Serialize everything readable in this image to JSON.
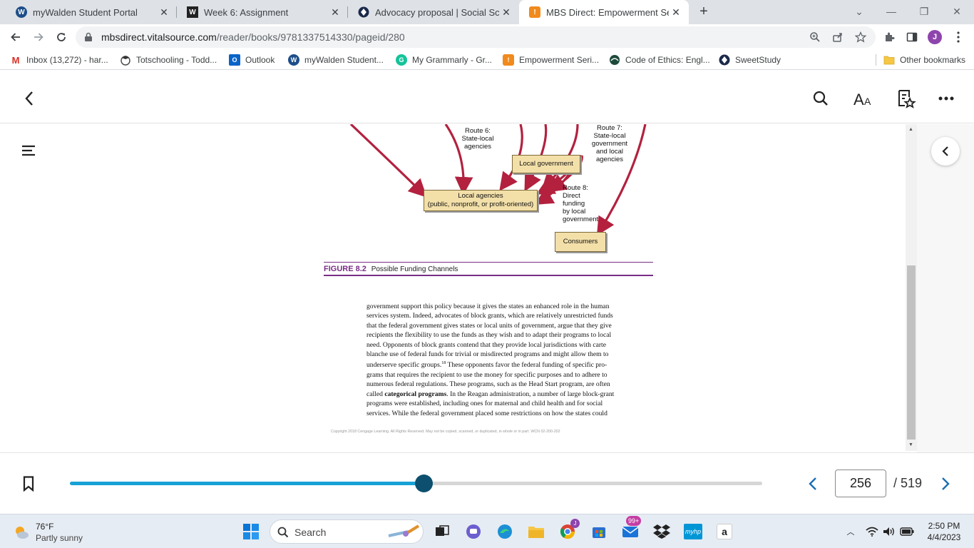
{
  "browser": {
    "tabs": [
      {
        "title": "myWalden Student Portal",
        "icon": "walden-icon",
        "icon_color": "#1d4e89",
        "icon_text": "W"
      },
      {
        "title": "Week 6: Assignment",
        "icon": "walden-w-icon",
        "icon_color": "#222222",
        "icon_text": "W"
      },
      {
        "title": "Advocacy proposal | Social Scienc",
        "icon": "sweetstudy-icon",
        "icon_color": "#1b2a4a",
        "icon_text": ""
      },
      {
        "title": "MBS Direct: Empowerment Serie",
        "icon": "mbs-icon",
        "icon_color": "#f08a1c",
        "icon_text": "!",
        "active": true
      }
    ],
    "url_host": "mbsdirect.vitalsource.com",
    "url_path": "/reader/books/9781337514330/pageid/280",
    "profile_initial": "J",
    "bookmarks": [
      {
        "label": "Inbox (13,272) - har...",
        "icon": "gmail-icon",
        "color": "#d93025",
        "text": "M"
      },
      {
        "label": "Totschooling - Todd...",
        "icon": "totschooling-icon",
        "color": "#555555",
        "text": ""
      },
      {
        "label": "Outlook",
        "icon": "outlook-icon",
        "color": "#0a64c8",
        "text": "O"
      },
      {
        "label": "myWalden Student...",
        "icon": "walden-icon",
        "color": "#1d4e89",
        "text": "W"
      },
      {
        "label": "My Grammarly - Gr...",
        "icon": "grammarly-icon",
        "color": "#15c39a",
        "text": "G"
      },
      {
        "label": "Empowerment Seri...",
        "icon": "mbs-icon",
        "color": "#f08a1c",
        "text": "!"
      },
      {
        "label": "Code of Ethics: Engl...",
        "icon": "nasw-icon",
        "color": "#1d4a3a",
        "text": ""
      },
      {
        "label": "SweetStudy",
        "icon": "sweetstudy-icon",
        "color": "#1b2a4a",
        "text": ""
      }
    ],
    "other_bookmarks": "Other bookmarks"
  },
  "figure": {
    "route6": [
      "Route 6:",
      "State-local",
      "agencies"
    ],
    "route7": [
      "Route 7:",
      "State-local",
      "government",
      "and local",
      "agencies"
    ],
    "route8": [
      "Route 8:",
      "Direct",
      "funding",
      "by local",
      "government"
    ],
    "local_government": "Local government",
    "local_agencies_1": "Local agencies",
    "local_agencies_2": "(public, nonprofit, or profit-oriented)",
    "consumers": "Consumers",
    "caption_number": "FIGURE 8.2",
    "caption_title": "Possible Funding Channels",
    "arrow_color": "#b3213f"
  },
  "body": {
    "line1": "government support this policy because it gives the states an enhanced role in the human",
    "line2": "services system. Indeed, advocates of block grants, which are relatively unrestricted funds",
    "line3": "that the federal government gives states or local units of government, argue that they give",
    "line4": "recipients the flexibility to use the funds as they wish and to adapt their programs to local",
    "line5": "need. Opponents of block grants contend that they provide local jurisdictions with carte",
    "line6": "blanche use of federal funds for trivial or misdirected programs and might allow them to",
    "line7_pre": "underserve specific groups.",
    "line7_sup": "18",
    "line7_post": " These opponents favor the federal funding of specific pro-",
    "line8": "grams that requires the recipient to use the money for specific purposes and to adhere to",
    "line9": "numerous federal regulations. These programs, such as the Head Start program, are often",
    "line10_pre": "called ",
    "line10_bold": "categorical programs",
    "line10_post": ". In the Reagan administration, a number of large block-grant",
    "line11": "programs were established, including ones for maternal and child health and for social",
    "line12": "services. While the federal government placed some restrictions on how the states could",
    "copyright": "Copyright 2018 Cengage Learning. All Rights Reserved. May not be copied, scanned, or duplicated, in whole or in part.  WCN 02-200-202"
  },
  "pager": {
    "current_page": "256",
    "total": "/ 519",
    "progress": 0.511,
    "accent": "#17a2d6",
    "knob": "#0d4f6e"
  },
  "taskbar": {
    "temp": "76°F",
    "condition": "Partly sunny",
    "search": "Search",
    "mail_badge": "99+",
    "time": "2:50 PM",
    "date": "4/4/2023"
  }
}
